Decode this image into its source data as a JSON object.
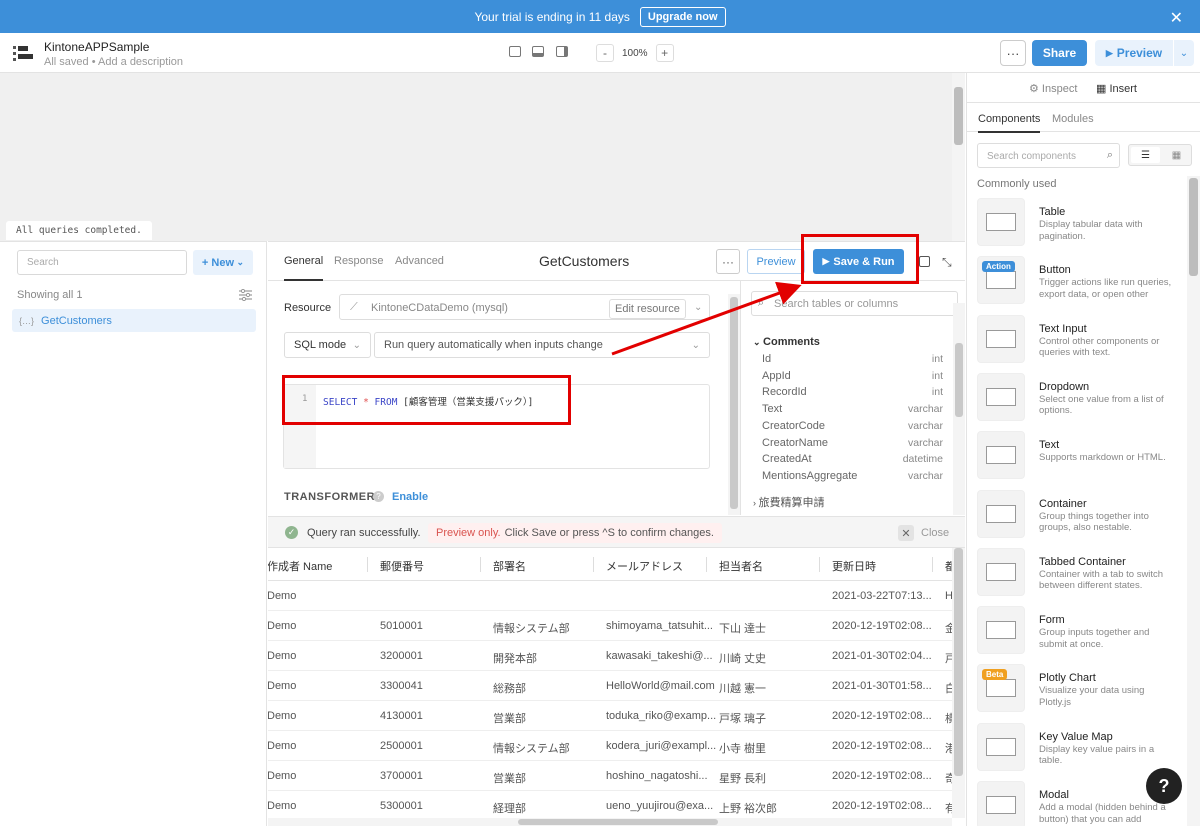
{
  "banner": {
    "message": "Your trial is ending in 11 days",
    "upgrade_label": "Upgrade now",
    "close": "✕"
  },
  "header": {
    "app_name": "KintoneAPPSample",
    "saved_status": "All saved",
    "description_link": "Add a description",
    "zoom_minus": "-",
    "zoom_level": "100%",
    "zoom_plus": "+",
    "more": "···",
    "share_label": "Share",
    "preview_label": "Preview",
    "preview_caret": "⌄"
  },
  "canvas": {
    "status": "All queries completed."
  },
  "queries": {
    "search_placeholder": "Search",
    "new_label": "New",
    "showing": "Showing all 1",
    "items": [
      "GetCustomers"
    ]
  },
  "editor": {
    "tabs": [
      "General",
      "Response",
      "Advanced"
    ],
    "query_name": "GetCustomers",
    "more": "···",
    "preview_label": "Preview",
    "save_run_label": "Save & Run",
    "resource_label": "Resource",
    "resource_value": "KintoneCDataDemo (mysql)",
    "edit_resource": "Edit resource",
    "mode": "SQL mode",
    "run_mode": "Run query automatically when inputs change",
    "line_number": "1",
    "code": {
      "kw1": "SELECT",
      "op": "*",
      "kw2": "FROM",
      "rest": "[顧客管理（営業支援パック）]"
    },
    "transformer_label": "TRANSFORMER",
    "enable_label": "Enable"
  },
  "schema": {
    "search_placeholder": "Search tables or columns",
    "table": "Comments",
    "columns": [
      {
        "name": "Id",
        "type": "int"
      },
      {
        "name": "AppId",
        "type": "int"
      },
      {
        "name": "RecordId",
        "type": "int"
      },
      {
        "name": "Text",
        "type": "varchar"
      },
      {
        "name": "CreatorCode",
        "type": "varchar"
      },
      {
        "name": "CreatorName",
        "type": "varchar"
      },
      {
        "name": "CreatedAt",
        "type": "datetime"
      },
      {
        "name": "MentionsAggregate",
        "type": "varchar"
      }
    ],
    "next_table": "旅費精算申請"
  },
  "results": {
    "success": "Query ran successfully.",
    "preview_only": "Preview only.",
    "preview_hint": "Click Save or press ^S to confirm changes.",
    "close_label": "Close",
    "columns": [
      "作成者 Name",
      "郵便番号",
      "部署名",
      "メールアドレス",
      "担当者名",
      "更新日時",
      "都"
    ],
    "rows": [
      [
        "Demo",
        "",
        "",
        "",
        "",
        "2021-03-22T07:13...",
        "H"
      ],
      [
        "Demo",
        "5010001",
        "情報システム部",
        "shimoyama_tatsuhit...",
        "下山 達士",
        "2020-12-19T02:08...",
        "金"
      ],
      [
        "Demo",
        "3200001",
        "開発本部",
        "kawasaki_takeshi@...",
        "川崎 丈史",
        "2021-01-30T02:04...",
        "戸"
      ],
      [
        "Demo",
        "3300041",
        "総務部",
        "HelloWorld@mail.com",
        "川越 憲一",
        "2021-01-30T01:58...",
        "白"
      ],
      [
        "Demo",
        "4130001",
        "営業部",
        "toduka_riko@examp...",
        "戸塚 璃子",
        "2020-12-19T02:08...",
        "横"
      ],
      [
        "Demo",
        "2500001",
        "情報システム部",
        "kodera_juri@exampl...",
        "小寺 樹里",
        "2020-12-19T02:08...",
        "港"
      ],
      [
        "Demo",
        "3700001",
        "営業部",
        "hoshino_nagatoshi...",
        "星野 長利",
        "2020-12-19T02:08...",
        "奇"
      ],
      [
        "Demo",
        "5300001",
        "経理部",
        "ueno_yuujirou@exa...",
        "上野 裕次郎",
        "2020-12-19T02:08...",
        "有"
      ]
    ]
  },
  "insert_panel": {
    "inspect_label": "Inspect",
    "insert_label": "Insert",
    "tab_components": "Components",
    "tab_modules": "Modules",
    "search_placeholder": "Search components",
    "section": "Commonly used",
    "components": [
      {
        "name": "Table",
        "desc": "Display tabular data with pagination."
      },
      {
        "name": "Button",
        "desc": "Trigger actions like run queries, export data, or open other",
        "badge": "Action"
      },
      {
        "name": "Text Input",
        "desc": "Control other components or queries with text."
      },
      {
        "name": "Dropdown",
        "desc": "Select one value from a list of options."
      },
      {
        "name": "Text",
        "desc": "Supports markdown or HTML."
      },
      {
        "name": "Container",
        "desc": "Group things together into groups, also nestable."
      },
      {
        "name": "Tabbed Container",
        "desc": "Container with a tab to switch between different states."
      },
      {
        "name": "Form",
        "desc": "Group inputs together and submit at once."
      },
      {
        "name": "Plotly Chart",
        "desc": "Visualize your data using Plotly.js",
        "badge": "Beta"
      },
      {
        "name": "Key Value Map",
        "desc": "Display key value pairs in a table."
      },
      {
        "name": "Modal",
        "desc": "Add a modal (hidden behind a button) that you can add"
      }
    ]
  },
  "help_label": "?",
  "colors": {
    "accent": "#3d8fd9",
    "annotation": "#e20000"
  }
}
